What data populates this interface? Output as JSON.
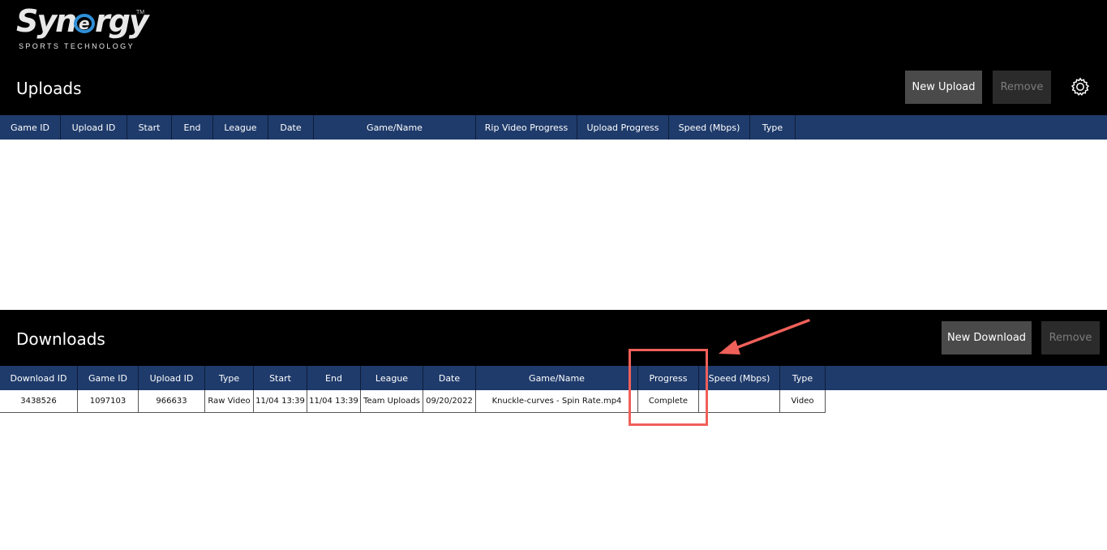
{
  "logo": {
    "brand": "Synergy",
    "tagline": "SPORTS TECHNOLOGY",
    "trademark": "TM"
  },
  "uploads": {
    "title": "Uploads",
    "new_label": "New Upload",
    "remove_label": "Remove",
    "columns": [
      "Game ID",
      "Upload ID",
      "Start",
      "End",
      "League",
      "Date",
      "Game/Name",
      "Rip Video Progress",
      "Upload Progress",
      "Speed (Mbps)",
      "Type"
    ]
  },
  "downloads": {
    "title": "Downloads",
    "new_label": "New Download",
    "remove_label": "Remove",
    "columns": [
      "Download ID",
      "Game ID",
      "Upload ID",
      "Type",
      "Start",
      "End",
      "League",
      "Date",
      "Game/Name",
      "Progress",
      "Speed (Mbps)",
      "Type"
    ],
    "rows": [
      [
        "3438526",
        "1097103",
        "966633",
        "Raw Video",
        "11/04 13:39",
        "11/04 13:39",
        "Team Uploads",
        "09/20/2022",
        "Knuckle-curves - Spin Rate.mp4",
        "Complete",
        "",
        "Video"
      ]
    ]
  },
  "colors": {
    "header_bg": "#000000",
    "table_header_bg": "#1f3b6b",
    "annotation": "#f0605a",
    "button_bg": "#4a4a4a"
  },
  "icons": {
    "settings": "gear-icon",
    "annotation_arrow": "arrow-icon"
  }
}
